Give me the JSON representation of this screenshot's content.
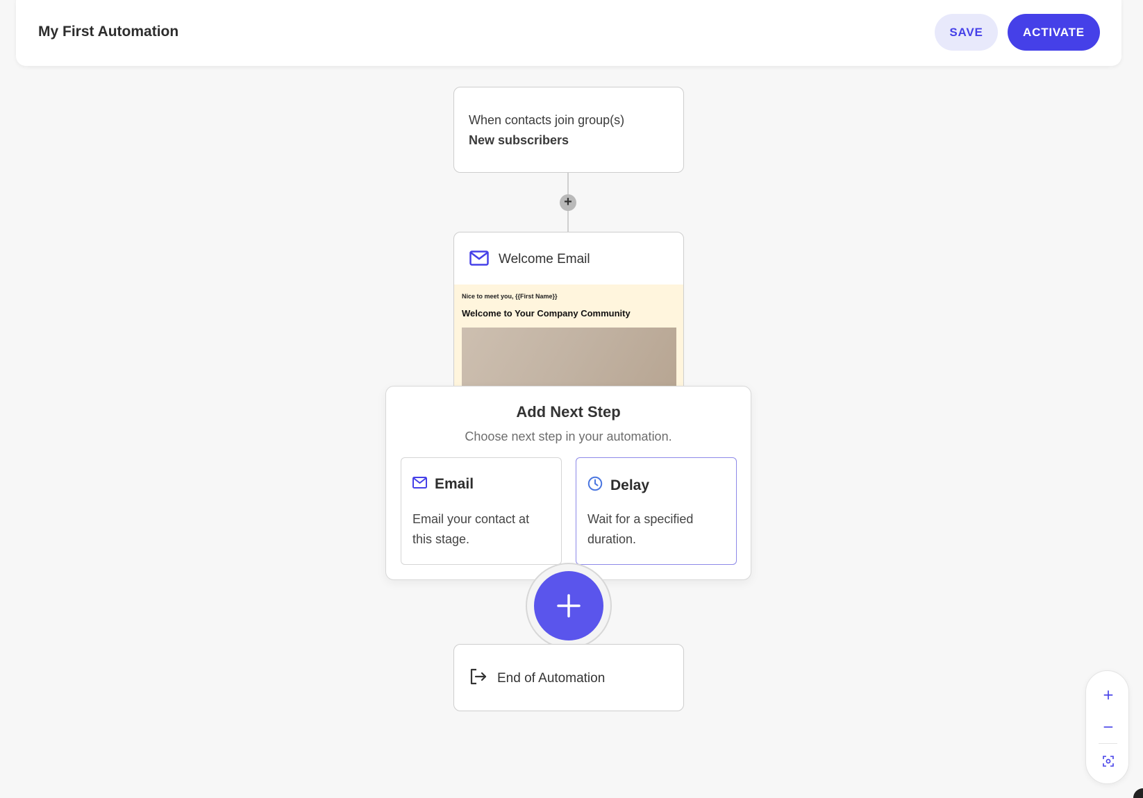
{
  "header": {
    "title": "My First Automation",
    "save_label": "SAVE",
    "activate_label": "ACTIVATE"
  },
  "trigger": {
    "line1": "When contacts join group(s)",
    "line2": "New subscribers"
  },
  "email_step": {
    "title": "Welcome Email",
    "preview_greeting": "Nice to meet you, {{First Name}}",
    "preview_heading": "Welcome to Your Company Community"
  },
  "add_next_step": {
    "title": "Add Next Step",
    "subtitle": "Choose next step in your automation.",
    "options": [
      {
        "label": "Email",
        "description": "Email your contact at this stage.",
        "icon": "mail-icon"
      },
      {
        "label": "Delay",
        "description": "Wait for a specified duration.",
        "icon": "clock-icon"
      }
    ]
  },
  "end_step": {
    "title": "End of Automation"
  },
  "zoom": {
    "zoom_in": "+",
    "zoom_out": "−"
  },
  "colors": {
    "accent": "#4540e8",
    "accent_light": "#e8e9fb",
    "preview_bg": "#fff5dd"
  }
}
